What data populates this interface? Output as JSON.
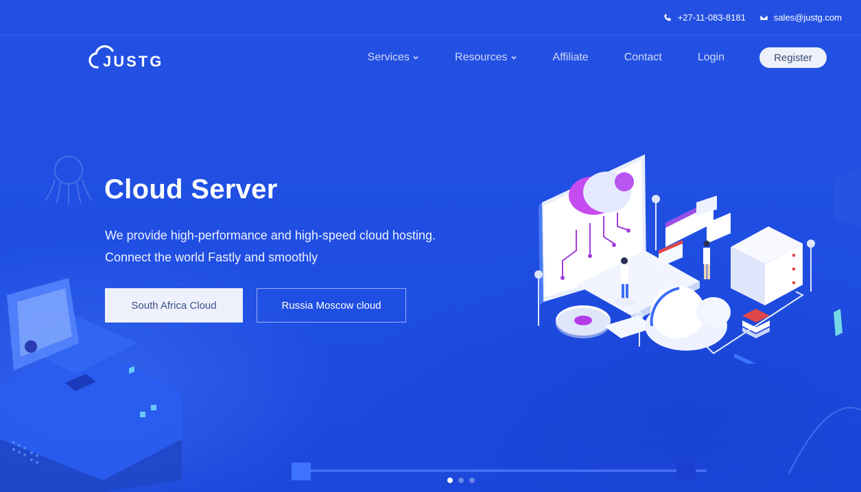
{
  "topbar": {
    "phone": "+27-11-083-8181",
    "email": "sales@justg.com",
    "phone_icon": "phone-icon",
    "email_icon": "envelope-icon"
  },
  "nav": {
    "logo_text": "JUSTG",
    "items": [
      {
        "label": "Services",
        "dropdown": true
      },
      {
        "label": "Resources",
        "dropdown": true
      },
      {
        "label": "Affiliate",
        "dropdown": false
      },
      {
        "label": "Contact",
        "dropdown": false
      },
      {
        "label": "Login",
        "dropdown": false
      }
    ],
    "register_label": "Register"
  },
  "hero": {
    "title": "Cloud Server",
    "line1": "We provide high-performance and high-speed cloud hosting.",
    "line2": "Connect the world Fastly and smoothly",
    "primary_button": "South Africa Cloud",
    "secondary_button": "Russia Moscow cloud"
  },
  "slider": {
    "slides": 3,
    "active_index": 0
  },
  "colors": {
    "background": "#2150e0",
    "button_light": "#eef1fb",
    "accent_purple": "#b43ce8"
  }
}
